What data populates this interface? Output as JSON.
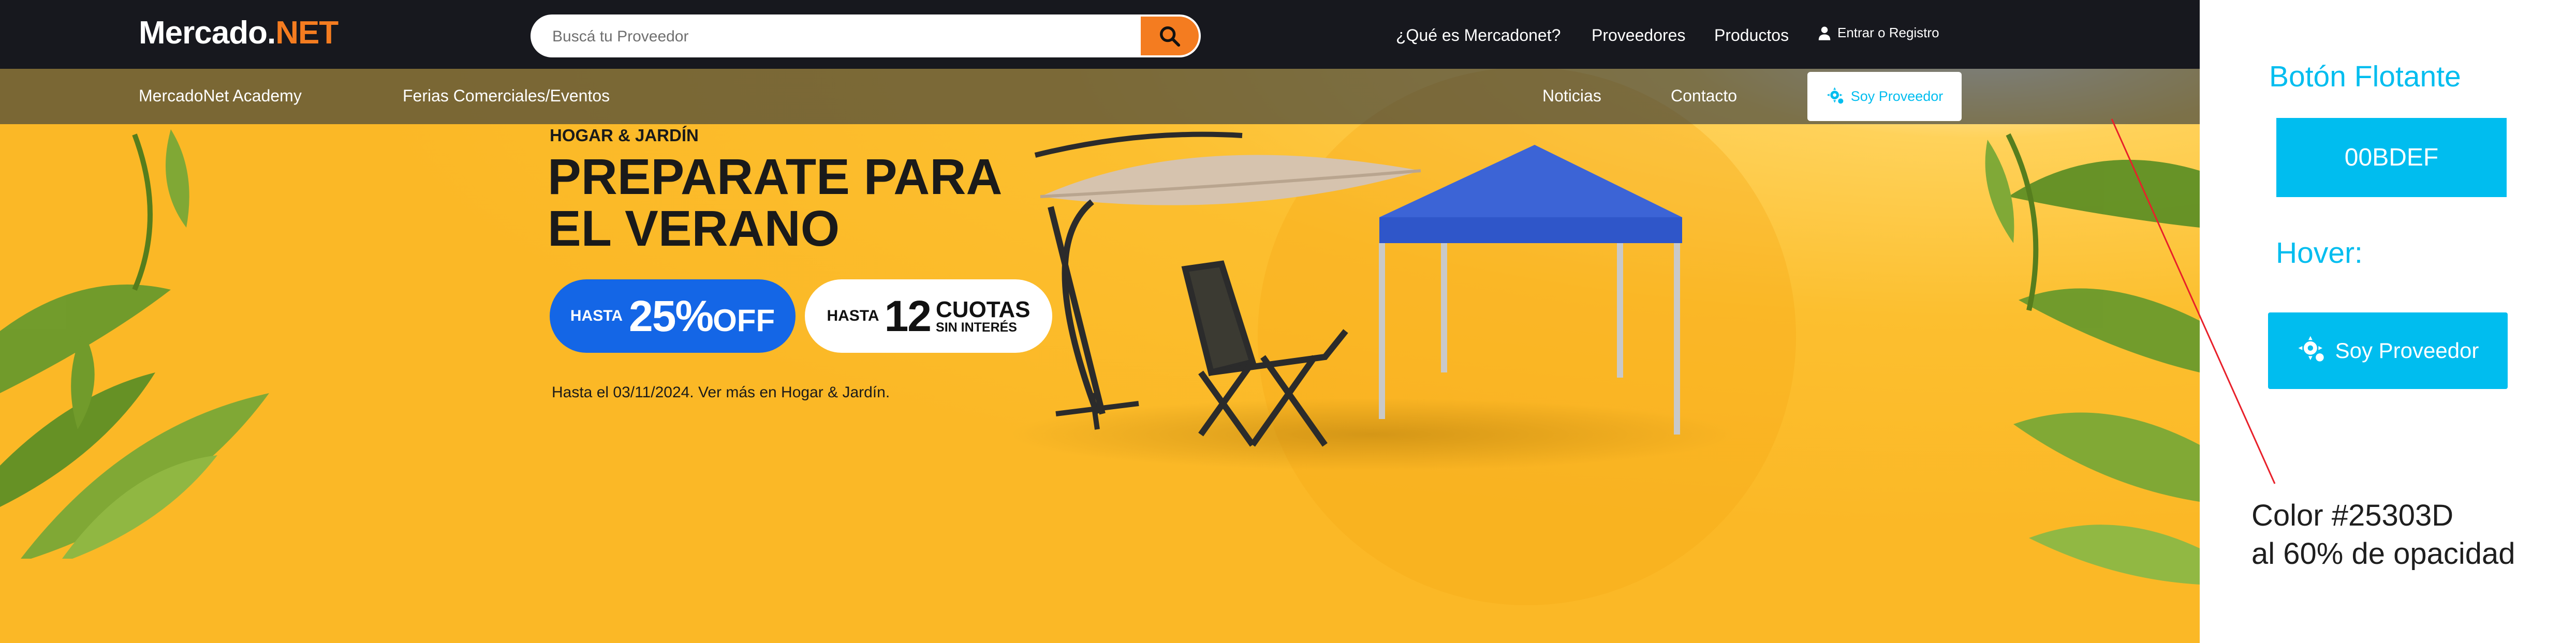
{
  "header": {
    "logo_main": "Mercado.",
    "logo_accent": "NET",
    "search_placeholder": "Buscá tu Proveedor",
    "nav": [
      "¿Qué es Mercadonet?",
      "Proveedores",
      "Productos"
    ],
    "login_label": "Entrar o Registro"
  },
  "subnav": {
    "left": [
      "MercadoNet Academy",
      "Ferias Comerciales/Eventos"
    ],
    "right": [
      "Noticias",
      "Contacto"
    ],
    "provider_button": "Soy Proveedor"
  },
  "promo": {
    "kicker": "HOGAR & JARDÍN",
    "title_line1": "PREPARATE PARA",
    "title_line2": "EL VERANO",
    "discount_prefix": "HASTA",
    "discount_value": "25%",
    "discount_suffix": "OFF",
    "cuotas_prefix": "HASTA",
    "cuotas_value": "12",
    "cuotas_word": "CUOTAS",
    "cuotas_sub": "SIN INTERÉS",
    "note": "Hasta el 03/11/2024. Ver más en Hogar & Jardín."
  },
  "annotation": {
    "title": "Botón Flotante",
    "swatch_code": "00BDEF",
    "hover_label": "Hover:",
    "hover_button": "Soy Proveedor",
    "note_line1": "Color #25303D",
    "note_line2": "al 60% de opacidad"
  },
  "colors": {
    "brand_accent": "#f47c20",
    "button_color": "#00BDEF",
    "topbar": "#17181e",
    "subnav_overlay": "#25303D",
    "subnav_opacity": "60%",
    "hero_background": "#fcbf2f",
    "discount_pill": "#1466e6"
  },
  "icons": {
    "search": "search-icon",
    "user": "user-icon",
    "provider": "gear-person-icon"
  }
}
